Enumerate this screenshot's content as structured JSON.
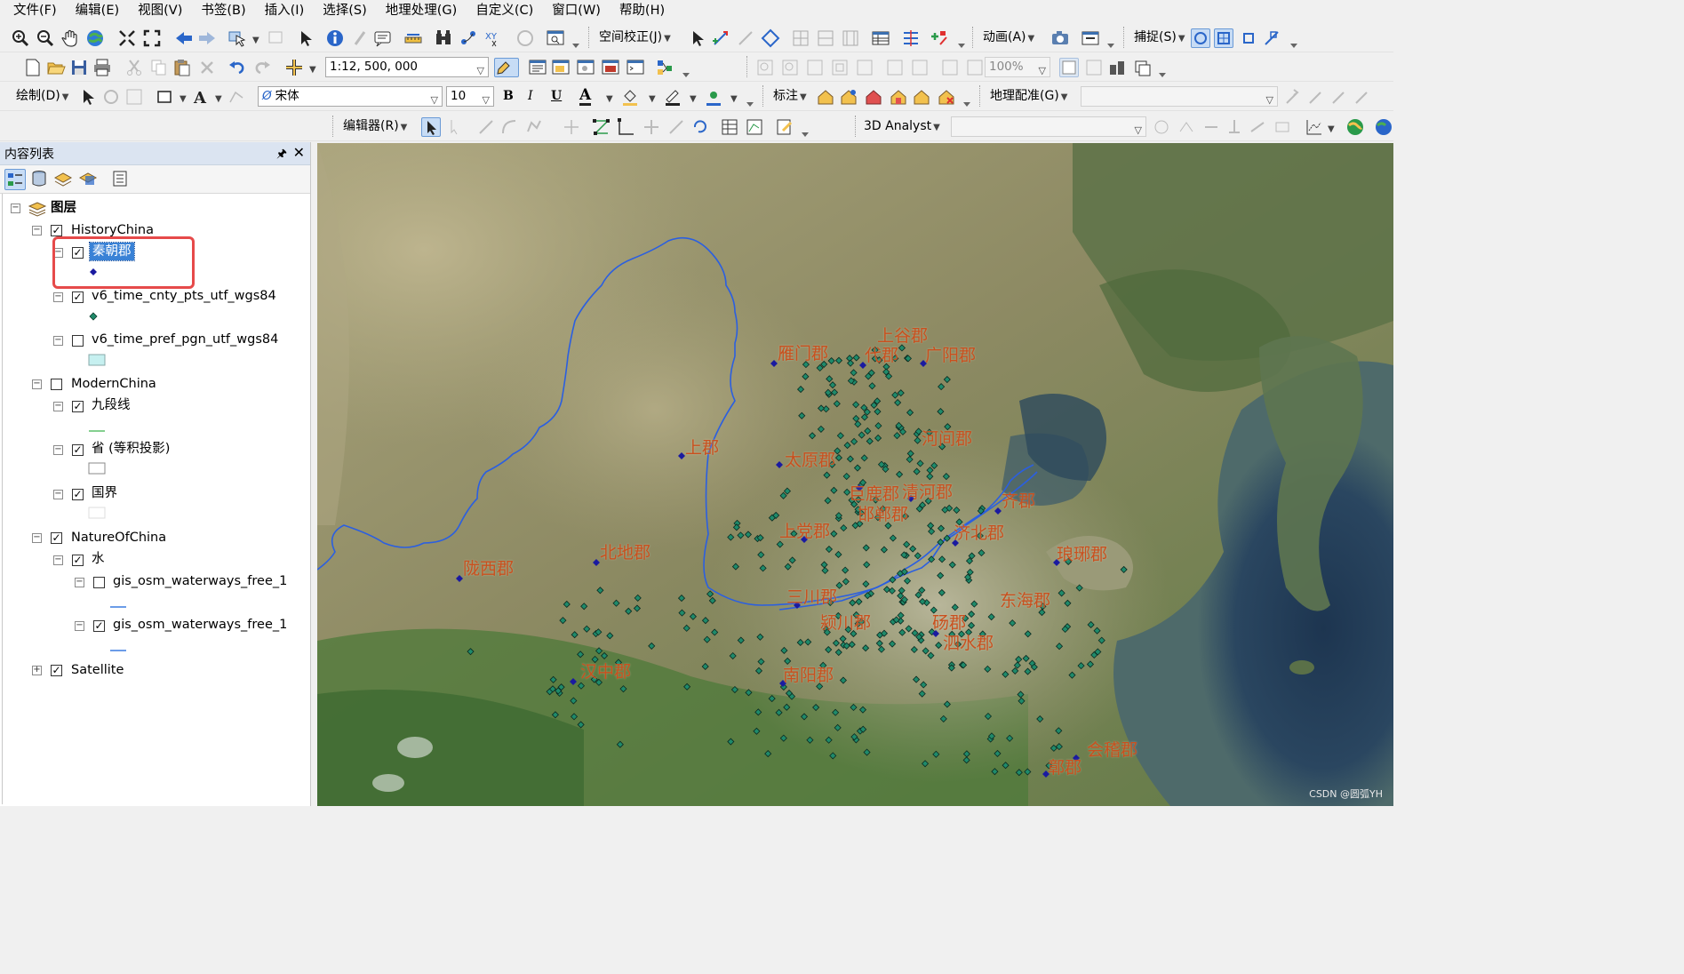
{
  "menubar": {
    "items": [
      "文件(F)",
      "编辑(E)",
      "视图(V)",
      "书签(B)",
      "插入(I)",
      "选择(S)",
      "地理处理(G)",
      "自定义(C)",
      "窗口(W)",
      "帮助(H)"
    ]
  },
  "toolbars": {
    "spatial_adjust": "空间校正(J)",
    "animation": "动画(A)",
    "snapping": "捕捉(S)",
    "scale": "1:12, 500, 000",
    "zoom_percent": "100%",
    "draw": "绘制(D)",
    "font": "宋体",
    "font_size": "10",
    "bold": "B",
    "italic": "I",
    "underline": "U",
    "font_color_glyph": "A",
    "labeling": "标注",
    "georeferencing": "地理配准(G)",
    "editor": "编辑器(R)",
    "analyst3d": "3D Analyst"
  },
  "toc": {
    "title": "内容列表",
    "pin_glyph": "🖈",
    "close_glyph": "✕",
    "root": "图层",
    "groups": [
      {
        "name": "HistoryChina",
        "checked": true
      },
      {
        "name": "ModernChina",
        "checked": false
      },
      {
        "name": "NatureOfChina",
        "checked": true
      },
      {
        "name": "Satellite",
        "checked": true
      }
    ],
    "layers": {
      "qin": "秦朝郡",
      "cnty_pts": "v6_time_cnty_pts_utf_wgs84",
      "pref_pgn": "v6_time_pref_pgn_utf_wgs84",
      "nine_dash": "九段线",
      "province": "省 (等积投影)",
      "border": "国界",
      "water": "水",
      "waterways_1": "gis_osm_waterways_free_1",
      "waterways_2": "gis_osm_waterways_free_1"
    }
  },
  "map": {
    "labels": [
      "上谷郡",
      "雁门郡",
      "代郡",
      "广阳郡",
      "河间郡",
      "上郡",
      "太原郡",
      "巨鹿郡",
      "清河郡",
      "邯郸郡",
      "齐郡",
      "上党郡",
      "济北郡",
      "琅琊郡",
      "陇西郡",
      "北地郡",
      "三川郡",
      "东海郡",
      "颍川郡",
      "砀郡",
      "泗水郡",
      "汉中郡",
      "南阳郡",
      "会稽郡",
      "鄣郡"
    ],
    "watermark": "CSDN @圆弧YH",
    "colors": {
      "label": "#c9501e",
      "river": "#2b5fe0",
      "county_pt": "#1f8a6a",
      "qin_pt": "#1a1aa0"
    }
  }
}
